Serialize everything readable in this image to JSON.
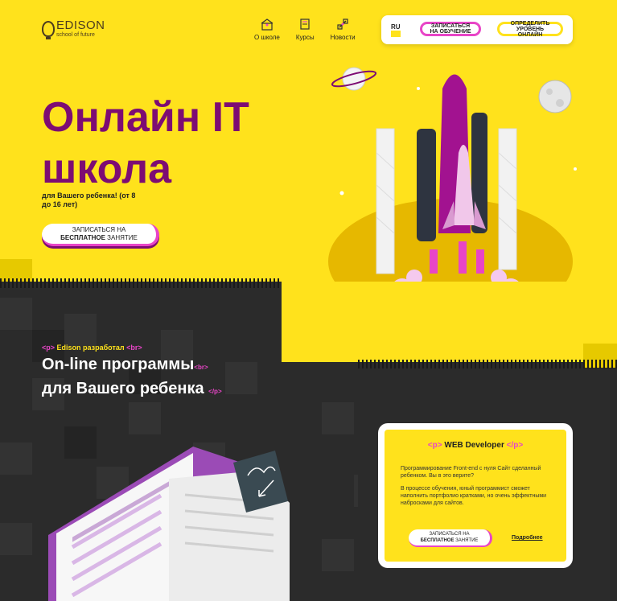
{
  "logo": {
    "name": "EDISON",
    "sub": "school of future"
  },
  "nav": [
    {
      "label": "О школе",
      "icon": "school-icon"
    },
    {
      "label": "Курсы",
      "icon": "book-icon"
    },
    {
      "label": "Новости",
      "icon": "satellite-icon"
    }
  ],
  "top_card": {
    "lang": "RU",
    "enroll_line1": "ЗАПИСАТЬСЯ",
    "enroll_line2": "НА ОБУЧЕНИЕ",
    "level_line1": "ОПРЕДЕЛИТЬ",
    "level_line2": "УРОВЕНЬ ОНЛАЙН"
  },
  "hero": {
    "title_line1": "Онлайн IT",
    "title_line2": "школа",
    "subtitle": "для Вашего ребенка! (от 8 до 16 лет)",
    "btn_line1": "ЗАПИСАТЬСЯ НА",
    "btn_bold": "БЕСПЛАТНОЕ",
    "btn_line2": "ЗАНЯТИЕ"
  },
  "programs": {
    "tag_open": "<p>",
    "intro": "Edison разработал",
    "tag_br": "<br>",
    "title_line1": "On-line программы",
    "title_line2": "для Вашего ребенка",
    "tag_close": "</p>"
  },
  "card": {
    "tag_open": "<p>",
    "title": "WEB Developer",
    "tag_close": "</p>",
    "text1": "Программирование Front-end с нуля Сайт сделанный ребенком. Вы в это верите?",
    "text2": "В процессе обучения, юный программист сможет наполнить портфолио крaтками, но очень эффектными набросками для сайтов.",
    "btn_line1": "ЗАПИСАТЬСЯ НА",
    "btn_bold": "БЕСПЛАТНОЕ",
    "btn_line2": "ЗАНЯТИЕ",
    "link": "Подробнее"
  },
  "colors": {
    "yellow": "#ffe21c",
    "purple": "#7d0c73",
    "pink": "#e845c7",
    "dark": "#2b2b2b"
  }
}
